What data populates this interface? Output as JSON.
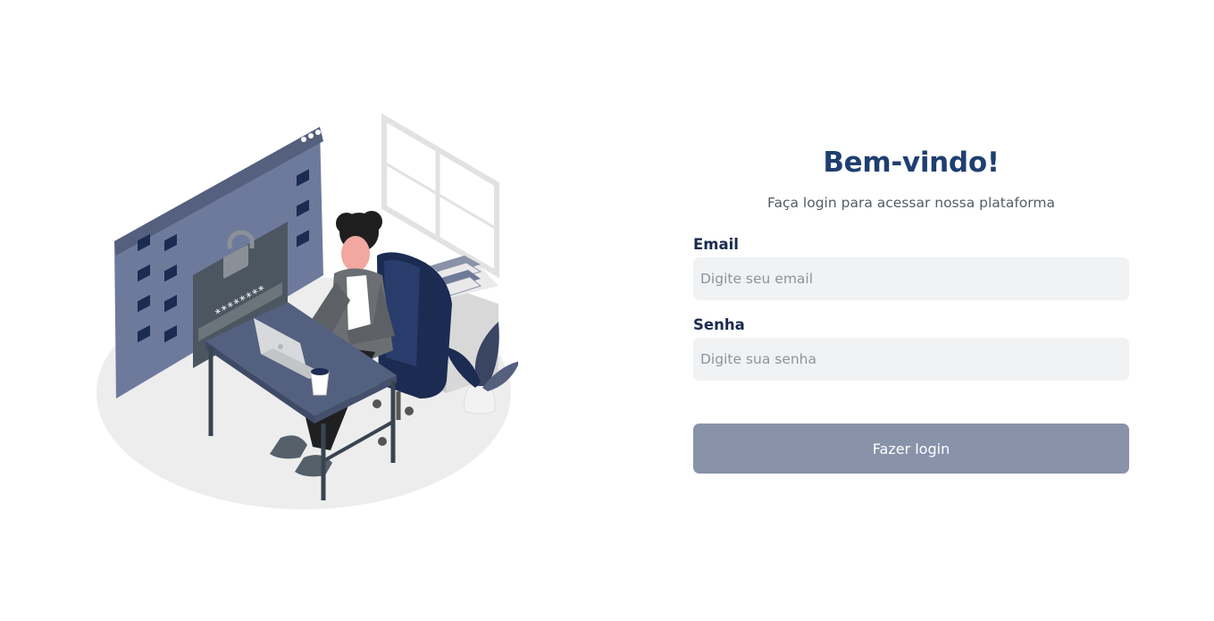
{
  "login": {
    "title": "Bem-vindo!",
    "subtitle": "Faça login para acessar nossa plataforma",
    "email_label": "Email",
    "email_placeholder": "Digite seu email",
    "email_value": "",
    "password_label": "Senha",
    "password_placeholder": "Digite sua senha",
    "password_value": "",
    "submit_label": "Fazer login"
  },
  "illustration": {
    "password_mask": "********",
    "icons": [
      "padlock-icon",
      "folder-icon",
      "laptop-icon",
      "coffee-cup-icon",
      "plant-icon",
      "books-icon"
    ]
  },
  "colors": {
    "title": "#1f3f70",
    "label": "#1a2a4f",
    "input_bg": "#f0f2f4",
    "button_bg": "#8892a9",
    "illustration_navy": "#1b2b52",
    "illustration_slate": "#6f7a9a"
  }
}
